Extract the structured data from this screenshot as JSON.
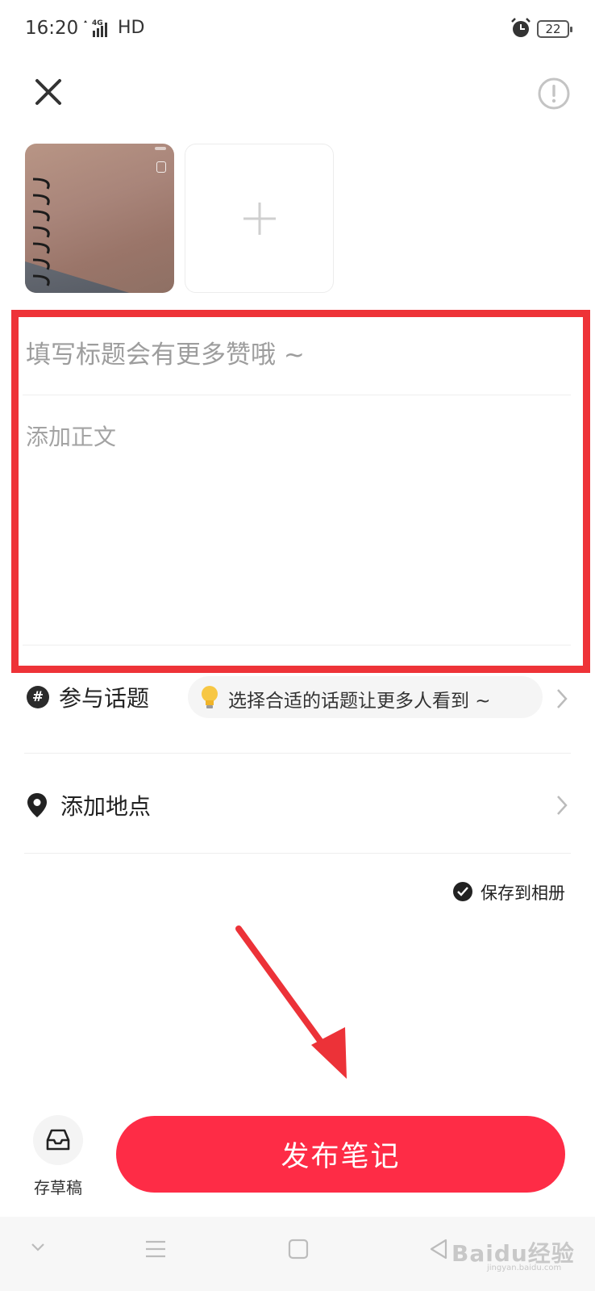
{
  "status_bar": {
    "time": "16:20",
    "network": "4G",
    "hd": "HD",
    "battery": "22"
  },
  "header": {
    "close_icon": "close-icon",
    "info_icon": "info-circle-icon"
  },
  "media": {
    "add_icon": "plus-icon"
  },
  "editor": {
    "title_placeholder": "填写标题会有更多赞哦 ~",
    "title_value": "",
    "body_placeholder": "添加正文",
    "body_value": "",
    "highlight_color": "#ee3338"
  },
  "topic": {
    "label": "参与话题",
    "icon": "hash-icon",
    "suggestion": "选择合适的话题让更多人看到 ~",
    "suggestion_icon": "lightbulb-icon"
  },
  "location": {
    "label": "添加地点",
    "icon": "location-pin-icon"
  },
  "save_album": {
    "label": "保存到相册",
    "checked": true
  },
  "footer": {
    "draft_label": "存草稿",
    "draft_icon": "inbox-icon",
    "publish_label": "发布笔记",
    "publish_color": "#fe2c46"
  },
  "watermark": {
    "brand": "Baidu经验",
    "url": "jingyan.baidu.com"
  }
}
